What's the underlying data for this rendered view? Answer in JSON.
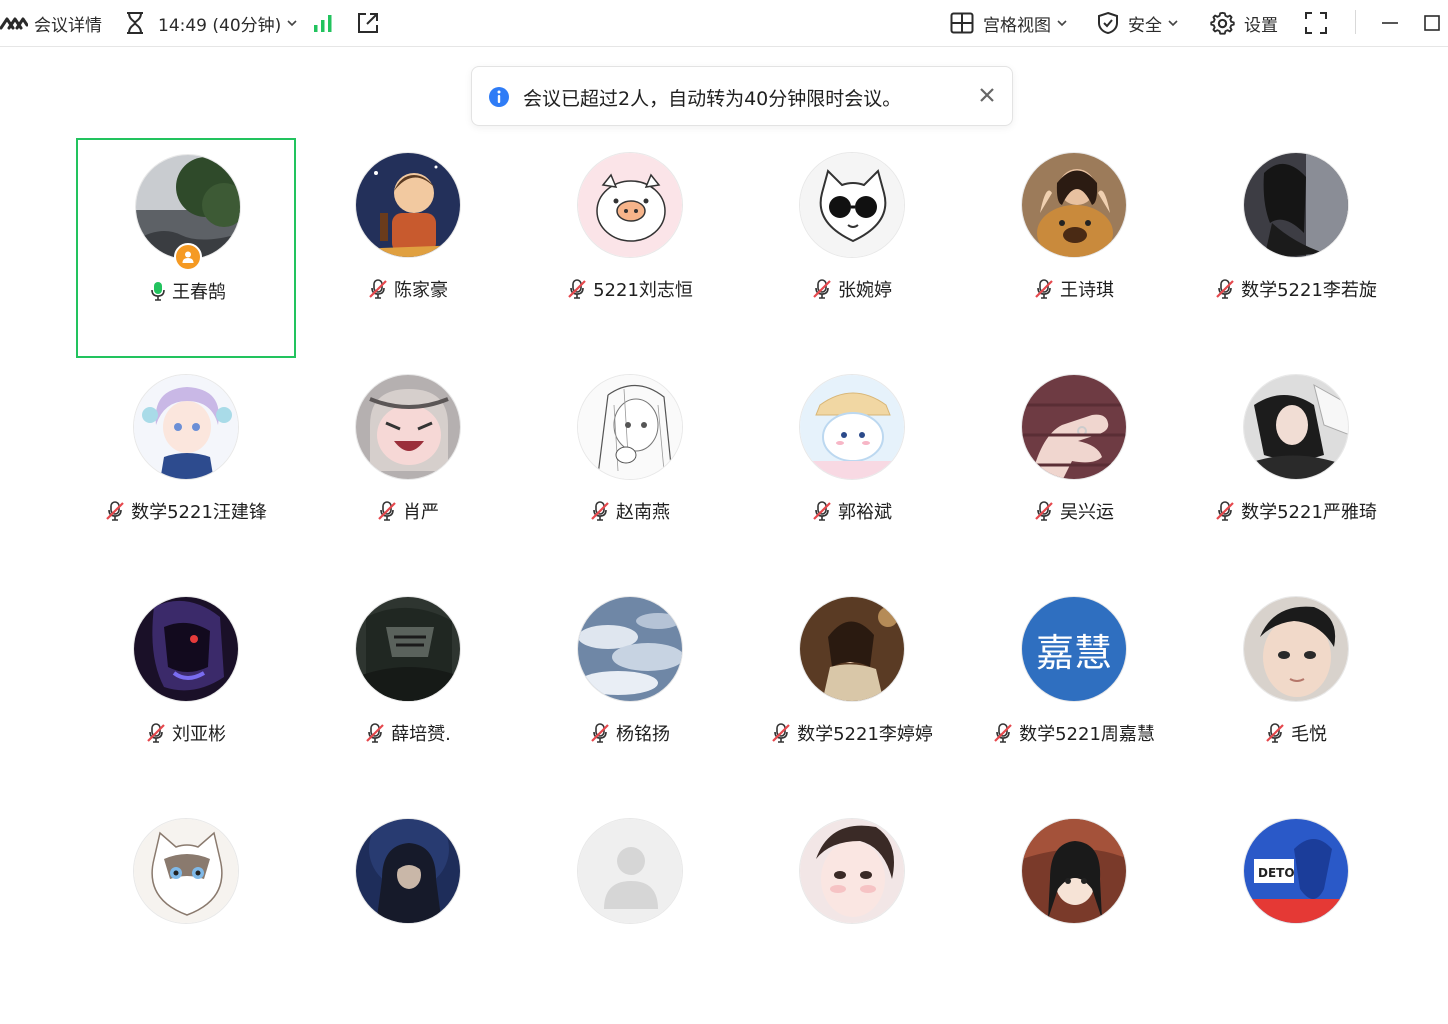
{
  "topbar": {
    "meeting_details": "会议详情",
    "time": "14:49 (40分钟)",
    "view_mode": "宫格视图",
    "security": "安全",
    "settings": "设置"
  },
  "notice": {
    "message": "会议已超过2人，自动转为40分钟限时会议。"
  },
  "participants": [
    {
      "name": "王春鹄",
      "mic": "on",
      "host": true,
      "avatar": "landscape-tree"
    },
    {
      "name": "陈家豪",
      "mic": "muted",
      "avatar": "anime-boy-night"
    },
    {
      "name": "5221刘志恒",
      "mic": "muted",
      "avatar": "pink-pig"
    },
    {
      "name": "张婉婷",
      "mic": "muted",
      "avatar": "cat-sunglasses"
    },
    {
      "name": "王诗琪",
      "mic": "muted",
      "avatar": "girl-with-dog"
    },
    {
      "name": "数学5221李若旋",
      "mic": "muted",
      "avatar": "girl-dark"
    },
    {
      "name": "数学5221汪建锋",
      "mic": "muted",
      "avatar": "anime-girl-blue"
    },
    {
      "name": "肖严",
      "mic": "muted",
      "avatar": "umaru-chan"
    },
    {
      "name": "赵南燕",
      "mic": "muted",
      "avatar": "sketch-girl"
    },
    {
      "name": "郭裕斌",
      "mic": "muted",
      "avatar": "cinnamoroll"
    },
    {
      "name": "吴兴运",
      "mic": "muted",
      "avatar": "hand-ring"
    },
    {
      "name": "数学5221严雅琦",
      "mic": "muted",
      "avatar": "girl-lying"
    },
    {
      "name": "刘亚彬",
      "mic": "muted",
      "avatar": "dark-figure"
    },
    {
      "name": "薛培赟.",
      "mic": "muted",
      "avatar": "dark-anime"
    },
    {
      "name": "杨铭扬",
      "mic": "muted",
      "avatar": "cloudy-sky"
    },
    {
      "name": "数学5221李婷婷",
      "mic": "muted",
      "avatar": "girl-warm"
    },
    {
      "name": "数学5221周嘉慧",
      "mic": "muted",
      "avatar": "text-avatar",
      "avatar_text": "嘉慧"
    },
    {
      "name": "毛悦",
      "mic": "muted",
      "avatar": "boy-face"
    },
    {
      "name": "",
      "mic": "",
      "avatar": "ragdoll-cat"
    },
    {
      "name": "",
      "mic": "",
      "avatar": "hooded-figure"
    },
    {
      "name": "",
      "mic": "",
      "avatar": "default-person"
    },
    {
      "name": "",
      "mic": "",
      "avatar": "girl-face"
    },
    {
      "name": "",
      "mic": "",
      "avatar": "anime-girl-red"
    },
    {
      "name": "",
      "mic": "",
      "avatar": "blue-poster"
    }
  ],
  "colors": {
    "active_border": "#22c35e",
    "signal_green": "#22c35e",
    "info_blue": "#2f7cf6",
    "host_orange": "#f59a23",
    "muted_red": "#e5484d",
    "text_avatar_bg": "#2f6fc0"
  }
}
